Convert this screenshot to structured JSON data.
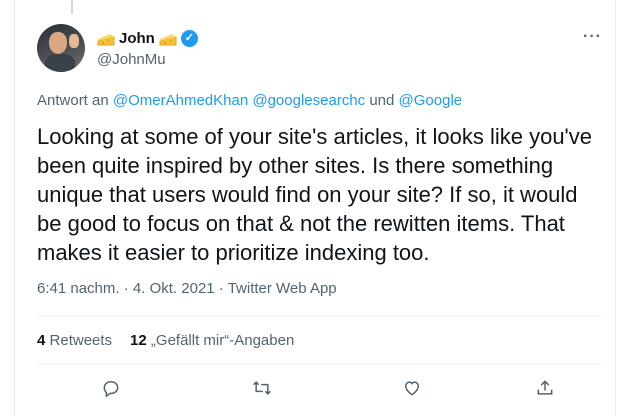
{
  "author": {
    "name": "John",
    "handle": "@JohnMu",
    "verified": true,
    "name_icons": [
      "cheese-icon",
      "cheese-icon"
    ]
  },
  "reply_to": {
    "prefix": "Antwort an",
    "mention1": "@OmerAhmedKhan",
    "mention2": "@googlesearchc",
    "joiner": "und",
    "mention3": "@Google"
  },
  "tweet": {
    "text": "Looking at some of your site's articles, it looks like you've been quite inspired by other sites. Is there something unique that users would find on your site? If so, it would be good to focus on that & not the rewitten items. That makes it easier to prioritize indexing too."
  },
  "meta": {
    "time": "6:41 nachm.",
    "dot1": "·",
    "date": "4. Okt. 2021",
    "dot2": "·",
    "source": "Twitter Web App"
  },
  "stats": {
    "retweets_count": "4",
    "retweets_label": "Retweets",
    "likes_count": "12",
    "likes_label": "„Gefällt mir“-Angaben"
  },
  "colors": {
    "accent": "#1d9bf0",
    "secondary_text": "#536471",
    "primary_text": "#0f1419"
  },
  "actions": [
    "reply-icon",
    "retweet-icon",
    "like-icon",
    "share-icon"
  ]
}
